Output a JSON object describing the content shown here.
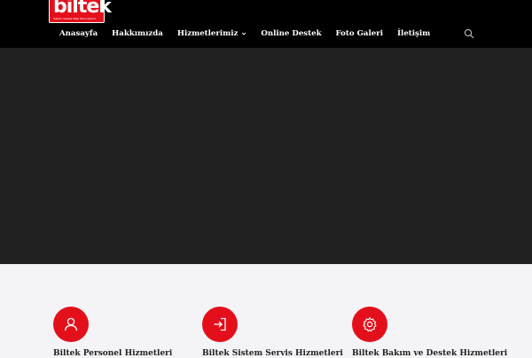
{
  "brand": {
    "name": "biltek",
    "tagline": "Sistem Destek Bilgi Teknolojileri",
    "accent": "#e3101b"
  },
  "nav": {
    "items": [
      {
        "label": "Anasayfa"
      },
      {
        "label": "Hakkımızda"
      },
      {
        "label": "Hizmetlerimiz",
        "dropdown": true
      },
      {
        "label": "Online Destek"
      },
      {
        "label": "Foto Galeri"
      },
      {
        "label": "İletişim"
      }
    ],
    "search_icon": "search-icon"
  },
  "hero": {
    "background": "#212121"
  },
  "services": [
    {
      "icon": "user-icon",
      "title": "Biltek Personel Hizmetleri"
    },
    {
      "icon": "sign-in-icon",
      "title": "Biltek Sistem Servis Hizmetleri"
    },
    {
      "icon": "gear-icon",
      "title": "Biltek Bakım ve Destek Hizmetleri"
    }
  ]
}
